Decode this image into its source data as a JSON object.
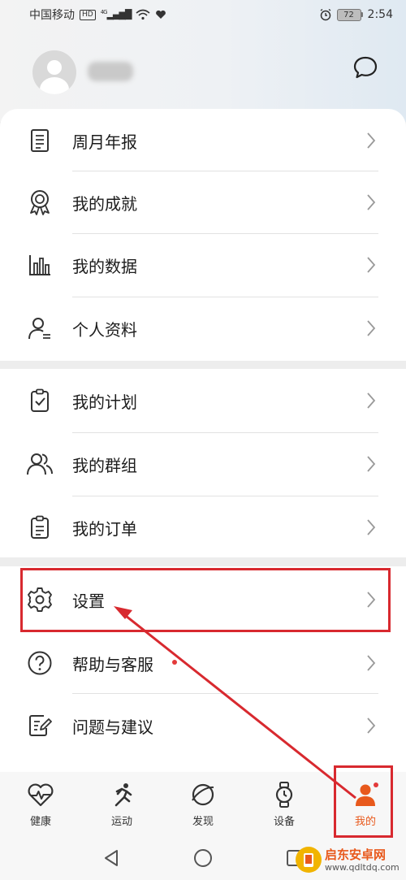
{
  "status_bar": {
    "carrier": "中国移动",
    "hd": "HD",
    "network": "4G",
    "battery": "72",
    "time": "2:54"
  },
  "profile": {
    "message_icon": "chat-bubble-icon"
  },
  "menu_groups": [
    [
      {
        "label": "周月年报",
        "icon": "report-icon"
      },
      {
        "label": "我的成就",
        "icon": "medal-icon"
      },
      {
        "label": "我的数据",
        "icon": "bar-chart-icon"
      },
      {
        "label": "个人资料",
        "icon": "profile-icon"
      }
    ],
    [
      {
        "label": "我的计划",
        "icon": "clipboard-check-icon"
      },
      {
        "label": "我的群组",
        "icon": "group-icon"
      },
      {
        "label": "我的订单",
        "icon": "order-icon"
      }
    ],
    [
      {
        "label": "设置",
        "icon": "gear-icon"
      },
      {
        "label": "帮助与客服",
        "icon": "help-icon"
      },
      {
        "label": "问题与建议",
        "icon": "feedback-icon"
      }
    ]
  ],
  "bottom_nav": [
    {
      "label": "健康",
      "icon": "heart-pulse-icon"
    },
    {
      "label": "运动",
      "icon": "running-icon"
    },
    {
      "label": "发现",
      "icon": "discover-icon"
    },
    {
      "label": "设备",
      "icon": "watch-icon"
    },
    {
      "label": "我的",
      "icon": "me-icon",
      "active": true
    }
  ],
  "watermark": {
    "title": "启东安卓网",
    "url": "www.qdltdq.com"
  },
  "colors": {
    "accent": "#e8591c",
    "annotation": "#d8292f",
    "notification_dot": "#e33a3a"
  }
}
